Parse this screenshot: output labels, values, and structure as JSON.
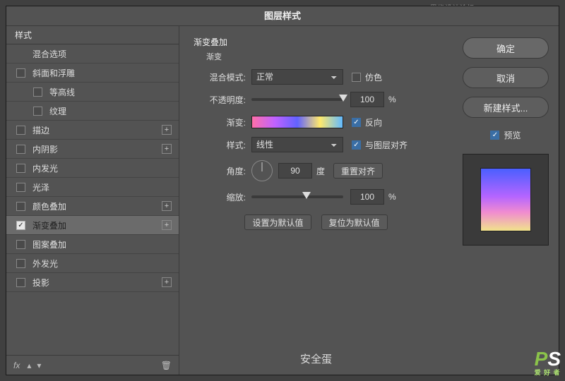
{
  "watermark_top": "思缘设计论坛  WWW.MISSYUAN.COM",
  "dialog_title": "图层样式",
  "sidebar": {
    "header": "样式",
    "blend_options": "混合选项",
    "items": [
      {
        "label": "斜面和浮雕",
        "checked": false,
        "plus": false,
        "indent": false
      },
      {
        "label": "等高线",
        "checked": false,
        "plus": false,
        "indent": true
      },
      {
        "label": "纹理",
        "checked": false,
        "plus": false,
        "indent": true
      },
      {
        "label": "描边",
        "checked": false,
        "plus": true,
        "indent": false
      },
      {
        "label": "内阴影",
        "checked": false,
        "plus": true,
        "indent": false
      },
      {
        "label": "内发光",
        "checked": false,
        "plus": false,
        "indent": false
      },
      {
        "label": "光泽",
        "checked": false,
        "plus": false,
        "indent": false
      },
      {
        "label": "颜色叠加",
        "checked": false,
        "plus": true,
        "indent": false
      },
      {
        "label": "渐变叠加",
        "checked": true,
        "plus": true,
        "indent": false
      },
      {
        "label": "图案叠加",
        "checked": false,
        "plus": false,
        "indent": false
      },
      {
        "label": "外发光",
        "checked": false,
        "plus": false,
        "indent": false
      },
      {
        "label": "投影",
        "checked": false,
        "plus": true,
        "indent": false
      }
    ],
    "footer_fx": "fx"
  },
  "form": {
    "group_title": "渐变叠加",
    "sub_title": "渐变",
    "blend_mode_label": "混合模式:",
    "blend_mode_value": "正常",
    "dither_label": "仿色",
    "opacity_label": "不透明度:",
    "opacity_value": "100",
    "opacity_pct": "%",
    "gradient_label": "渐变:",
    "reverse_label": "反向",
    "style_label": "样式:",
    "style_value": "线性",
    "align_label": "与图层对齐",
    "angle_label": "角度:",
    "angle_value": "90",
    "angle_deg": "度",
    "reset_align": "重置对齐",
    "scale_label": "缩放:",
    "scale_value": "100",
    "scale_pct": "%",
    "set_default": "设置为默认值",
    "reset_default": "复位为默认值"
  },
  "right": {
    "ok": "确定",
    "cancel": "取消",
    "new_style": "新建样式...",
    "preview": "预览"
  },
  "bottom_text": "安全蛋",
  "ps_mark": {
    "p": "P",
    "s": "S",
    "t": "爱 好 者"
  }
}
